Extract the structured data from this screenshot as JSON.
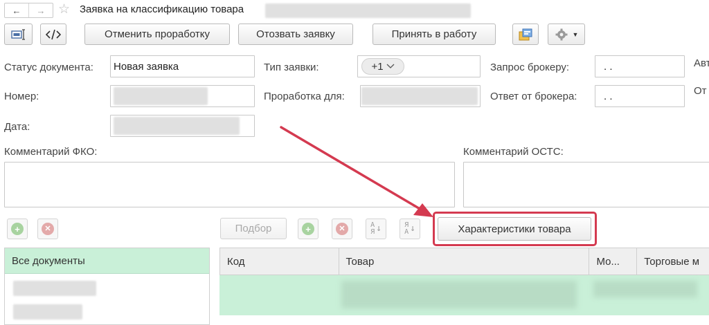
{
  "window": {
    "title": "Заявка на классификацию товара",
    "nav_back_icon": "arrow-left-icon",
    "nav_forward_icon": "arrow-right-icon",
    "favorite_icon": "star-icon"
  },
  "toolbar": {
    "cancel_processing_label": "Отменить проработку",
    "recall_request_label": "Отозвать заявку",
    "accept_label": "Принять в работу",
    "more_icon": "gear-icon"
  },
  "form": {
    "status_label": "Статус документа:",
    "status_value": "Новая заявка",
    "number_label": "Номер:",
    "date_label": "Дата:",
    "request_type_label": "Тип заявки:",
    "request_type_value": "+1",
    "processing_for_label": "Проработка для:",
    "broker_request_label": "Запрос брокеру:",
    "broker_request_value": ". .",
    "broker_response_label": "Ответ от брокера:",
    "broker_response_value": ". .",
    "right_label_1": "Авт",
    "right_label_2": "От",
    "comment_fko_label": "Комментарий ФКО:",
    "comment_ostc_label": "Комментарий ОСТС:"
  },
  "list_toolbar": {
    "select_label": "Подбор",
    "characteristics_label": "Характеристики товара"
  },
  "left_panel": {
    "all_documents_label": "Все документы"
  },
  "table": {
    "columns": [
      "Код",
      "Товар",
      "Мо...",
      "Торговые м"
    ]
  },
  "colors": {
    "highlight_red": "#d43a50",
    "selection_green": "#c9f0d8",
    "accent_green": "#a8d3a0"
  }
}
